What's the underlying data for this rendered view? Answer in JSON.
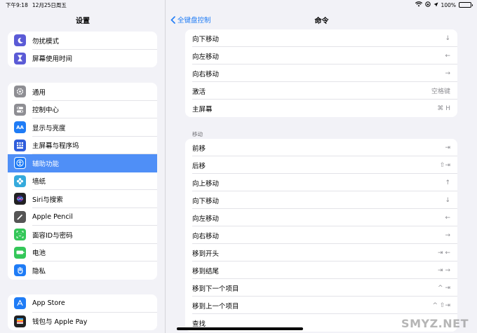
{
  "status": {
    "time": "下午9:18",
    "date": "12月25日周五",
    "battery": "100%"
  },
  "sidebar": {
    "title": "设置",
    "group1": [
      {
        "label": "勿扰模式",
        "icon": "moon-icon",
        "color": "#5b5bd6"
      },
      {
        "label": "屏幕使用时间",
        "icon": "hourglass-icon",
        "color": "#5b5bd6"
      }
    ],
    "group2": [
      {
        "label": "通用",
        "icon": "gear-icon",
        "color": "#8e8e93"
      },
      {
        "label": "控制中心",
        "icon": "switches-icon",
        "color": "#8e8e93"
      },
      {
        "label": "显示与亮度",
        "icon": "aa-icon",
        "color": "#1f7cf6"
      },
      {
        "label": "主屏幕与程序坞",
        "icon": "grid-icon",
        "color": "#2f5ddb"
      },
      {
        "label": "辅助功能",
        "icon": "accessibility-icon",
        "color": "#1f7cf6",
        "active": true
      },
      {
        "label": "墙纸",
        "icon": "flower-icon",
        "color": "#35aadc"
      },
      {
        "label": "Siri与搜索",
        "icon": "siri-icon",
        "color": "#222"
      },
      {
        "label": "Apple Pencil",
        "icon": "pencil-icon",
        "color": "#555"
      },
      {
        "label": "面容ID与密码",
        "icon": "faceid-icon",
        "color": "#34c759"
      },
      {
        "label": "电池",
        "icon": "battery-icon",
        "color": "#34c759"
      },
      {
        "label": "隐私",
        "icon": "hand-icon",
        "color": "#1f7cf6"
      }
    ],
    "group3": [
      {
        "label": "App Store",
        "icon": "appstore-icon",
        "color": "#1f7cf6"
      },
      {
        "label": "钱包与 Apple Pay",
        "icon": "wallet-icon",
        "color": "#222"
      }
    ]
  },
  "nav": {
    "back_label": "全键盘控制",
    "title": "命令"
  },
  "card1": [
    {
      "label": "向下移动",
      "key": "↓"
    },
    {
      "label": "向左移动",
      "key": "←"
    },
    {
      "label": "向右移动",
      "key": "→"
    },
    {
      "label": "激活",
      "key": "空格键"
    },
    {
      "label": "主屏幕",
      "key": "⌘ H"
    }
  ],
  "section_move": "移动",
  "card2": [
    {
      "label": "前移",
      "key": "⇥"
    },
    {
      "label": "后移",
      "key": "⇧⇥"
    },
    {
      "label": "向上移动",
      "key": "↑"
    },
    {
      "label": "向下移动",
      "key": "↓"
    },
    {
      "label": "向左移动",
      "key": "←"
    },
    {
      "label": "向右移动",
      "key": "→"
    },
    {
      "label": "移到开头",
      "key": "⇥ ←"
    },
    {
      "label": "移到结尾",
      "key": "⇥ →"
    },
    {
      "label": "移到下一个项目",
      "key": "^ ⇥"
    },
    {
      "label": "移到上一个项目",
      "key": "^ ⇧⇥"
    },
    {
      "label": "查找",
      "key": ""
    }
  ],
  "watermark": "SMYZ.NET"
}
